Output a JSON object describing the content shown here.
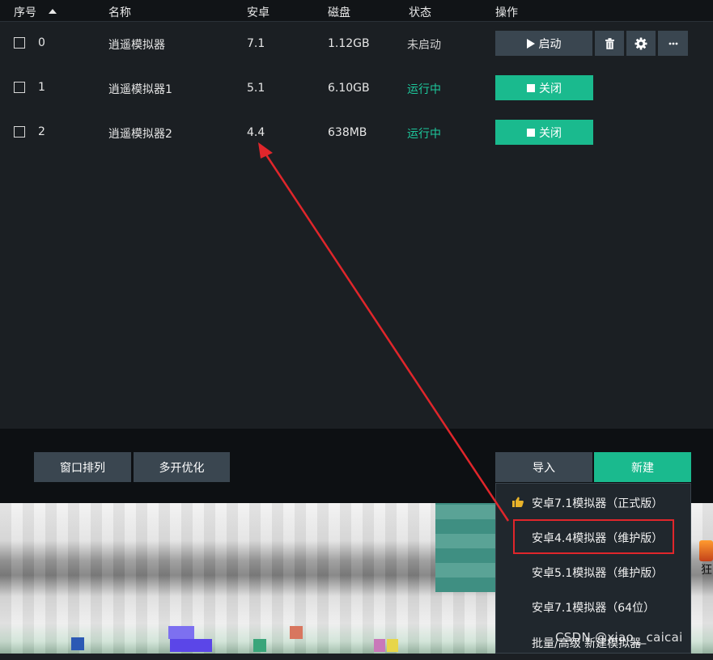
{
  "table": {
    "columns": {
      "index": "序号",
      "name": "名称",
      "android": "安卓",
      "disk": "磁盘",
      "status": "状态",
      "actions": "操作"
    },
    "rows": [
      {
        "index": "0",
        "name": "逍遥模拟器",
        "android": "7.1",
        "disk": "1.12GB",
        "status": "未启动",
        "status_state": "stopped",
        "action_label": "启动"
      },
      {
        "index": "1",
        "name": "逍遥模拟器1",
        "android": "5.1",
        "disk": "6.10GB",
        "status": "运行中",
        "status_state": "running",
        "action_label": "关闭"
      },
      {
        "index": "2",
        "name": "逍遥模拟器2",
        "android": "4.4",
        "disk": "638MB",
        "status": "运行中",
        "status_state": "running",
        "action_label": "关闭"
      }
    ],
    "row0_extra_icons": [
      "trash-icon",
      "gear-icon",
      "more-icon"
    ]
  },
  "footer": {
    "arrange_label": "窗口排列",
    "optimize_label": "多开优化",
    "import_label": "导入",
    "new_label": "新建"
  },
  "dropdown": {
    "items": [
      "安卓7.1模拟器（正式版）",
      "安卓4.4模拟器（维护版）",
      "安卓5.1模拟器（维护版）",
      "安卓7.1模拟器（64位）",
      "批量/高级 新建模拟器"
    ],
    "highlighted_item": "安卓4.4模拟器（维护版）"
  },
  "background_side_text": "狂",
  "watermark": "CSDN @xiao__caicai",
  "colors": {
    "accent_green": "#1aba8e",
    "running_text": "#1dc89c",
    "annotation_red": "#e0262b",
    "dark_button": "#3a4650"
  }
}
